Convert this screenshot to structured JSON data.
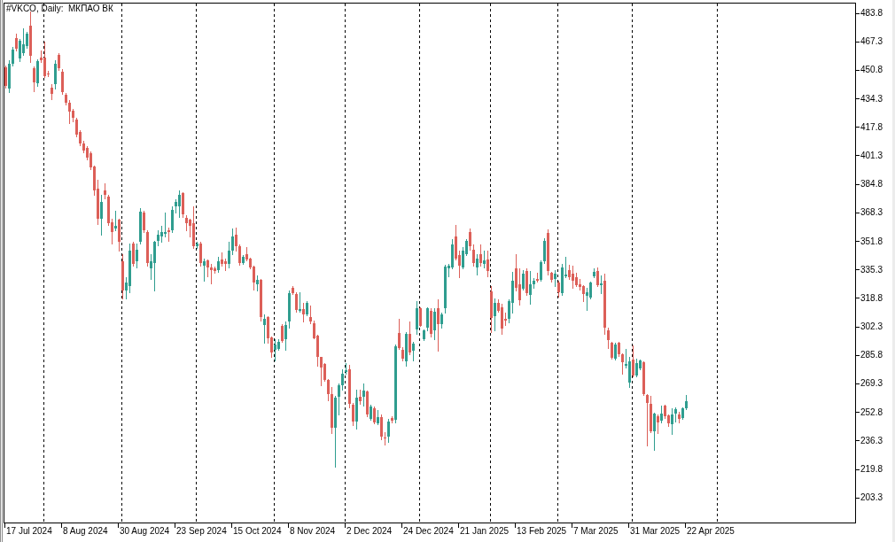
{
  "chart": {
    "title": "#VKCO, Daily:  МКПАО ВК",
    "price_axis": [
      "483.8",
      "467.3",
      "450.8",
      "434.3",
      "417.8",
      "401.3",
      "384.8",
      "368.3",
      "351.8",
      "335.3",
      "318.8",
      "302.3",
      "285.8",
      "269.3",
      "252.8",
      "236.3",
      "219.8",
      "203.3"
    ],
    "time_axis": [
      "17 Jul 2024",
      "8 Aug 2024",
      "30 Aug 2024",
      "23 Sep 2024",
      "15 Oct 2024",
      "8 Nov 2024",
      "2 Dec 2024",
      "24 Dec 2024",
      "21 Jan 2025",
      "13 Feb 2025",
      "7 Mar 2025",
      "31 Mar 2025",
      "22 Apr 2025"
    ]
  }
}
